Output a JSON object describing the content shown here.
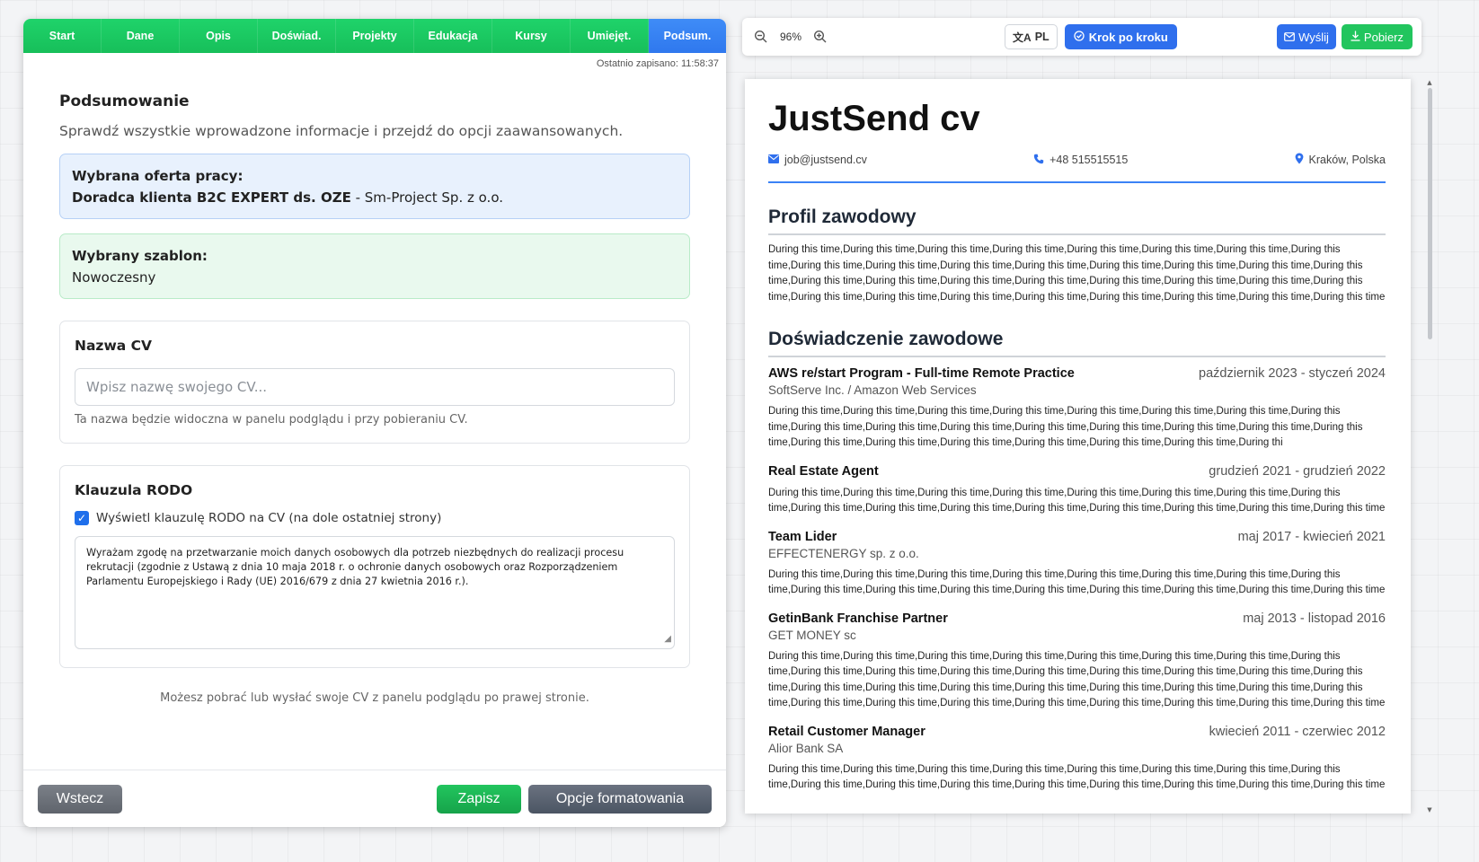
{
  "steps": [
    "Start",
    "Dane",
    "Opis",
    "Doświad.",
    "Projekty",
    "Edukacja",
    "Kursy",
    "Umiejęt.",
    "Podsum."
  ],
  "active_step": "Podsum.",
  "last_saved": "Ostatnio zapisano: 11:58:37",
  "summary": {
    "title": "Podsumowanie",
    "description": "Sprawdź wszystkie wprowadzone informacje i przejdź do opcji zaawansowanych.",
    "job_offer_label": "Wybrana oferta pracy:",
    "job_offer_title": "Doradca klienta B2C EXPERT ds. OZE",
    "job_offer_company": " - Sm-Project Sp. z o.o.",
    "template_label": "Wybrany szablon:",
    "template_value": "Nowoczesny"
  },
  "cv_name_card": {
    "title": "Nazwa CV",
    "placeholder": "Wpisz nazwę swojego CV...",
    "value": "",
    "help": "Ta nazwa będzie widoczna w panelu podglądu i przy pobieraniu CV."
  },
  "rodo": {
    "title": "Klauzula RODO",
    "checkbox_label": "Wyświetl klauzulę RODO na CV (na dole ostatniej strony)",
    "checked": true,
    "text": "Wyrażam zgodę na przetwarzanie moich danych osobowych dla potrzeb niezbędnych do realizacji procesu rekrutacji (zgodnie z Ustawą z dnia 10 maja 2018 r. o ochronie danych osobowych oraz Rozporządzeniem Parlamentu Europejskiego i Rady (UE) 2016/679 z dnia 27 kwietnia 2016 r.)."
  },
  "bottom_note": "Możesz pobrać lub wysłać swoje CV z panelu podglądu po prawej stronie.",
  "footer": {
    "back": "Wstecz",
    "save": "Zapisz",
    "format": "Opcje formatowania"
  },
  "toolbar": {
    "zoom": "96%",
    "lang": "PL",
    "step_by_step": "Krok po kroku",
    "send": "Wyślij",
    "download": "Pobierz"
  },
  "cv": {
    "name": "JustSend cv",
    "email": "job@justsend.cv",
    "phone": "+48 515515515",
    "location": "Kraków, Polska",
    "profile_heading": "Profil zawodowy",
    "profile_text": "During this time,During this time,During this time,During this time,During this time,During this time,During this time,During this time,During this time,During this time,During this time,During this time,During this time,During this time,During this time,During this time,During this time,During this time,During this time,During this time,During this time,During this time,During this time,During this time,During this time,During this time,During this time,During this time,During this time,During this time,During this time,During this time",
    "experience_heading": "Doświadczenie zawodowe",
    "jobs": [
      {
        "title": "AWS re/start Program - Full-time Remote Practice",
        "dates": "październik 2023 - styczeń 2024",
        "company": "SoftServe Inc. / Amazon Web Services",
        "desc": "During this time,During this time,During this time,During this time,During this time,During this time,During this time,During this time,During this time,During this time,During this time,During this time,During this time,During this time,During this time,During this time,During this time,During this time,During this time,During this time,During this time,During this time,During thi"
      },
      {
        "title": "Real Estate Agent",
        "dates": "grudzień 2021 - grudzień 2022",
        "company": "",
        "desc": "During this time,During this time,During this time,During this time,During this time,During this time,During this time,During this time,During this time,During this time,During this time,During this time,During this time,During this time,During this time,During this time"
      },
      {
        "title": "Team Lider",
        "dates": "maj 2017 - kwiecień 2021",
        "company": "EFFECTENERGY sp. z o.o.",
        "desc": "During this time,During this time,During this time,During this time,During this time,During this time,During this time,During this time,During this time,During this time,During this time,During this time,During this time,During this time,During this time,During this time"
      },
      {
        "title": "GetinBank Franchise Partner",
        "dates": "maj 2013 - listopad 2016",
        "company": "GET MONEY sc",
        "desc": "During this time,During this time,During this time,During this time,During this time,During this time,During this time,During this time,During this time,During this time,During this time,During this time,During this time,During this time,During this time,During this time,During this time,During this time,During this time,During this time,During this time,During this time,During this time,During this time,During this time,During this time,During this time,During this time,During this time,During this time,During this time,During this time"
      },
      {
        "title": "Retail Customer Manager",
        "dates": "kwiecień 2011 - czerwiec 2012",
        "company": "Alior Bank SA",
        "desc": "During this time,During this time,During this time,During this time,During this time,During this time,During this time,During this time,During this time,During this time,During this time,During this time,During this time,During this time,During this time,During this time"
      }
    ]
  },
  "colors": {
    "step_green": "#1fd36a",
    "step_active": "#3f8cf7",
    "primary_blue": "#2f6fed",
    "success_green": "#22c55e",
    "cv_rule": "#3b82f6"
  },
  "icons": {
    "zoom_out": "zoom-out-icon",
    "zoom_in": "zoom-in-icon",
    "translate": "translate-icon",
    "step": "check-circle-icon",
    "send": "mail-icon",
    "download": "download-icon",
    "email": "envelope-icon",
    "phone": "phone-icon",
    "location": "map-pin-icon"
  }
}
